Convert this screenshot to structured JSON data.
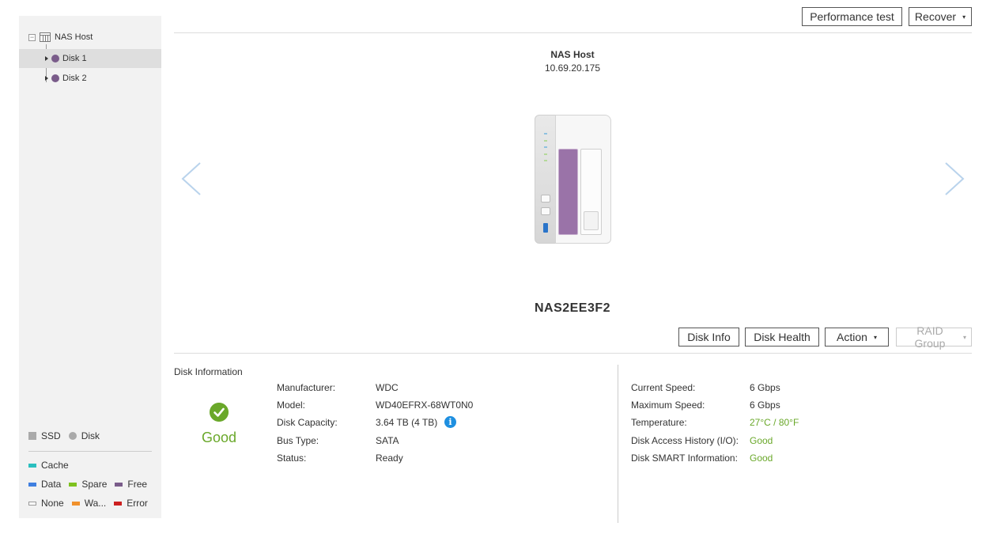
{
  "sidebar": {
    "host_label": "NAS Host",
    "toggle_glyph": "−",
    "disks": [
      {
        "label": "Disk 1",
        "selected": true
      },
      {
        "label": "Disk 2",
        "selected": false
      }
    ],
    "legend": {
      "ssd": "SSD",
      "disk": "Disk",
      "cache": "Cache",
      "data": "Data",
      "spare": "Spare",
      "free": "Free",
      "none": "None",
      "warning": "Wa...",
      "error": "Error"
    }
  },
  "header": {
    "performance_test": "Performance test",
    "recover": "Recover",
    "caret": "▾"
  },
  "device": {
    "host_title": "NAS Host",
    "ip": "10.69.20.175",
    "name": "NAS2EE3F2"
  },
  "actions": {
    "disk_info": "Disk Info",
    "disk_health": "Disk Health",
    "action": "Action",
    "raid_group": "RAID Group"
  },
  "disk_information": {
    "title": "Disk Information",
    "status_summary": "Good",
    "left": [
      {
        "label": "Manufacturer:",
        "value": "WDC"
      },
      {
        "label": "Model:",
        "value": "WD40EFRX-68WT0N0"
      },
      {
        "label": "Disk Capacity:",
        "value": "3.64 TB (4 TB)"
      },
      {
        "label": "Bus Type:",
        "value": "SATA"
      },
      {
        "label": "Status:",
        "value": "Ready"
      }
    ],
    "right": [
      {
        "label": "Current Speed:",
        "value": "6 Gbps"
      },
      {
        "label": "Maximum Speed:",
        "value": "6 Gbps"
      },
      {
        "label": "Temperature:",
        "value": "27°C / 80°F"
      },
      {
        "label": "Disk Access History (I/O):",
        "value": "Good"
      },
      {
        "label": "Disk SMART Information:",
        "value": "Good"
      }
    ],
    "info_glyph": "i"
  },
  "colors": {
    "good": "#6aa82a",
    "cache": "#2bbfbf",
    "data": "#3f7fe0",
    "spare": "#7ec21f",
    "free": "#7a5c8a",
    "warning": "#f0912c",
    "error": "#cc2020",
    "info": "#1e8fe0"
  }
}
